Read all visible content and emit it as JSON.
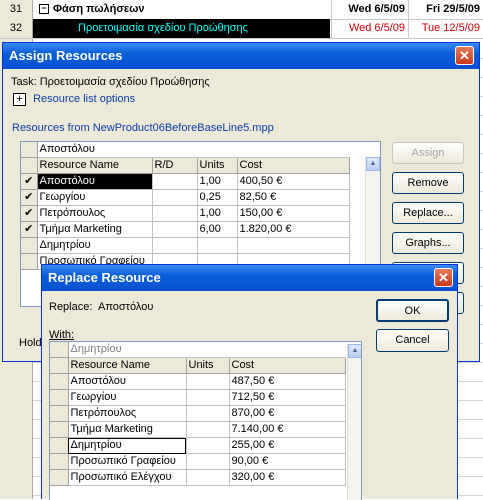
{
  "sheet": {
    "rows": [
      {
        "num": "31",
        "name": "Φάση πωλήσεων",
        "start": "Wed 6/5/09",
        "finish": "Fri 29/5/09",
        "bold": true
      },
      {
        "num": "32",
        "name": "Προετοιμασία σχεδίου Προώθησης",
        "start": "Wed 6/5/09",
        "finish": "Tue 12/5/09",
        "bold": false
      }
    ],
    "summary_icon": "collapse-box-icon"
  },
  "assign": {
    "title": "Assign Resources",
    "task_label": "Task: Προετοιμασία σχεδίου Προώθησης",
    "options_label": "Resource list options",
    "resources_from": "Resources from NewProduct06BeforeBaseLine5.mpp",
    "edit_value": "Αποστόλου",
    "columns": [
      "Resource Name",
      "R/D",
      "Units",
      "Cost"
    ],
    "rows": [
      {
        "check": "✔",
        "name": "Αποστόλου",
        "rd": "",
        "units": "1,00",
        "cost": "400,50 €"
      },
      {
        "check": "✔",
        "name": "Γεωργίου",
        "rd": "",
        "units": "0,25",
        "cost": "82,50 €"
      },
      {
        "check": "✔",
        "name": "Πετρόπουλος",
        "rd": "",
        "units": "1,00",
        "cost": "150,00 €"
      },
      {
        "check": "✔",
        "name": "Τμήμα Marketing",
        "rd": "",
        "units": "6,00",
        "cost": "1.820,00 €"
      },
      {
        "check": "",
        "name": "Δημητρίου",
        "rd": "",
        "units": "",
        "cost": ""
      },
      {
        "check": "",
        "name": "Προσωπικό Γραφείου",
        "rd": "",
        "units": "",
        "cost": ""
      }
    ],
    "buttons": {
      "assign": "Assign",
      "remove": "Remove",
      "replace": "Replace...",
      "graphs": "Graphs..."
    },
    "hold_label": "Hold"
  },
  "replace": {
    "title": "Replace Resource",
    "replace_label": "Replace:",
    "replace_value": "Αποστόλου",
    "with_label": "With:",
    "edit_value": "Δημητρίου",
    "columns": [
      "Resource Name",
      "Units",
      "Cost"
    ],
    "rows": [
      {
        "name": "Αποστόλου",
        "units": "",
        "cost": "487,50 €"
      },
      {
        "name": "Γεωργίου",
        "units": "",
        "cost": "712,50 €"
      },
      {
        "name": "Πετρόπουλος",
        "units": "",
        "cost": "870,00 €"
      },
      {
        "name": "Τμήμα Marketing",
        "units": "",
        "cost": "7.140,00 €"
      },
      {
        "name": "Δημητρίου",
        "units": "",
        "cost": "255,00 €"
      },
      {
        "name": "Προσωπικό Γραφείου",
        "units": "",
        "cost": "90,00 €"
      },
      {
        "name": "Προσωπικό Ελέγχου",
        "units": "",
        "cost": "320,00 €"
      }
    ],
    "buttons": {
      "ok": "OK",
      "cancel": "Cancel"
    }
  },
  "colors": {
    "titlebar": "#0a5fd8",
    "date_red": "#cc0000",
    "task_text": "#00ffff",
    "task_bg": "#000000"
  }
}
